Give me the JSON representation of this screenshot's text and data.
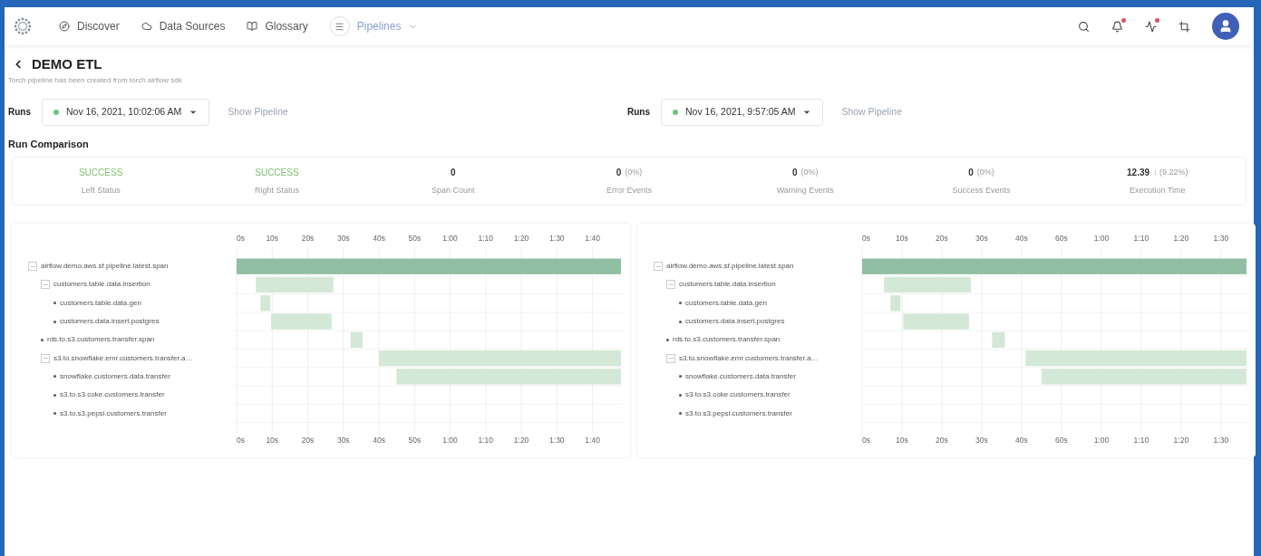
{
  "nav": {
    "items": [
      {
        "kind": "compass",
        "label": "Discover",
        "selected": false
      },
      {
        "kind": "cloud",
        "label": "Data Sources",
        "selected": false
      },
      {
        "kind": "book",
        "label": "Glossary",
        "selected": false
      },
      {
        "kind": "menu",
        "label": "Pipelines",
        "selected": true
      }
    ],
    "icons": [
      {
        "kind": "search",
        "alert": false
      },
      {
        "kind": "bell",
        "alert": true
      },
      {
        "kind": "activity",
        "alert": true
      },
      {
        "kind": "crop",
        "alert": false
      }
    ]
  },
  "page": {
    "title": "DEMO ETL",
    "subtitle": "Torch pipeline has been created from torch airflow sdk"
  },
  "runs": [
    {
      "label": "Runs",
      "value": "Nov 16, 2021, 10:02:06 AM",
      "color": "#6cc47f",
      "link": "Show Pipeline"
    },
    {
      "label": "Runs",
      "value": "Nov 16, 2021, 9:57:05 AM",
      "color": "#6cc47f",
      "link": "Show Pipeline"
    }
  ],
  "comparison": {
    "title": "Run Comparison",
    "metrics": [
      {
        "kind": "status",
        "value": "SUCCESS",
        "label": "Left Status"
      },
      {
        "kind": "status",
        "value": "SUCCESS",
        "label": "Right Status"
      },
      {
        "kind": "count",
        "value": "0",
        "label": "Span Count"
      },
      {
        "kind": "count",
        "value": "0",
        "detail": "(0%)",
        "label": "Error Events"
      },
      {
        "kind": "count",
        "value": "0",
        "detail": "(0%)",
        "label": "Warning Events"
      },
      {
        "kind": "count",
        "value": "0",
        "detail": "(0%)",
        "label": "Success Events"
      },
      {
        "kind": "count",
        "value": "12.39",
        "detail": "↓ (9.22%)",
        "label": "Execution Time"
      }
    ]
  },
  "timelines": [
    {
      "tree": [
        {
          "label": "airflow.demo.aws.sf.pipeline.latest.span",
          "expanded": true,
          "children": [
            {
              "label": "customers.table.data.insertion",
              "expanded": true,
              "children": [
                {
                  "label": "customers.table.data.gen"
                },
                {
                  "label": "customers.data.insert.postgres"
                }
              ]
            },
            {
              "label": "rds.to.s3.customers.transfer.span"
            },
            {
              "label": "s3.to.snowflake.emr.customers.transfer.a…",
              "expanded": true,
              "children": [
                {
                  "label": "snowflake.customers.data.transfer"
                },
                {
                  "label": "s3.to.s3.coke.customers.transfer"
                },
                {
                  "label": "s3.to.s3.pepsi.customers.transfer"
                }
              ]
            }
          ]
        }
      ],
      "axis_top": [
        "0s",
        "10s",
        "20s",
        "30s",
        "40s",
        "50s",
        "1:00",
        "1:10",
        "1:20",
        "1:30",
        "1:40"
      ],
      "axis_bottom": [
        "0s",
        "10s",
        "20s",
        "30s",
        "40s",
        "50s",
        "1:00",
        "1:10",
        "1:20",
        "1:30",
        "1:40"
      ]
    },
    {
      "tree": [
        {
          "label": "airflow.demo.aws.sf.pipeline.latest.span",
          "expanded": true,
          "children": [
            {
              "label": "customers.table.data.insertion",
              "expanded": true,
              "children": [
                {
                  "label": "customers.table.data.gen"
                },
                {
                  "label": "customers.data.insert.postgres"
                }
              ]
            },
            {
              "label": "rds.to.s3.customers.transfer.span"
            },
            {
              "label": "s3.to.snowflake.emr.customers.transfer.a…",
              "expanded": true,
              "children": [
                {
                  "label": "snowflake.customers.data.transfer"
                },
                {
                  "label": "s3.to.s3.coke.customers.transfer"
                },
                {
                  "label": "s3.to.s3.pepsi.customers.transfer"
                }
              ]
            }
          ]
        }
      ],
      "axis_top": [
        "0s",
        "10s",
        "20s",
        "30s",
        "40s",
        "60s",
        "1:00",
        "1:10",
        "1:20",
        "1:30"
      ],
      "axis_bottom": [
        "0s",
        "10s",
        "20s",
        "30s",
        "40s",
        "60s",
        "1:00",
        "1:10",
        "1:20",
        "1:30"
      ]
    }
  ]
}
